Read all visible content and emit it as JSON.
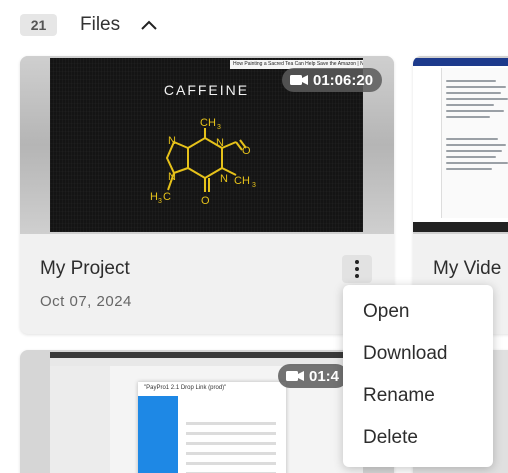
{
  "header": {
    "count": "21",
    "title": "Files",
    "collapse_icon": "chevron-up-icon"
  },
  "cards": [
    {
      "title": "My Project",
      "date": "Oct 07, 2024",
      "duration": "01:06:20",
      "thumb_heading": "CAFFEINE",
      "thumb_tooltip": "How Painting a Sacred Tea Can Help Save the Amazon | National ..."
    },
    {
      "title": "My Vide"
    },
    {
      "duration": "01:4"
    }
  ],
  "menu": {
    "items": [
      "Open",
      "Download",
      "Rename",
      "Delete"
    ]
  },
  "card3_thumb": {
    "modal_title": "\"PayPro1 2.1 Drop Link (prod)\""
  },
  "colors": {
    "molecule": "#e6c21a",
    "duration_bg": "#5a5a5a",
    "card_bg": "#f1f1f1"
  }
}
